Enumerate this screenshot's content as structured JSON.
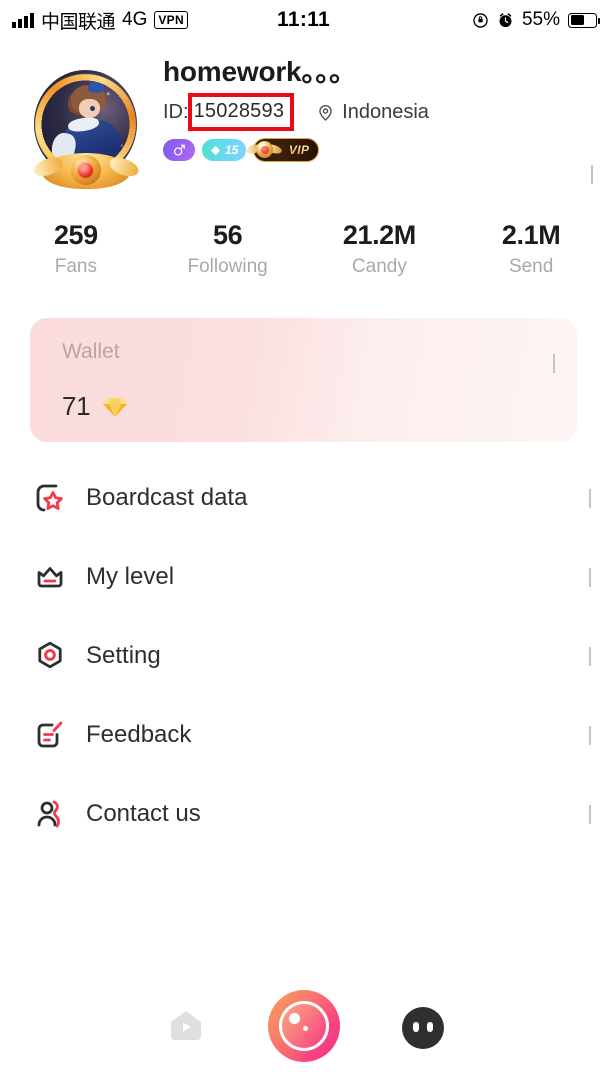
{
  "status_bar": {
    "carrier": "中国联通",
    "network": "4G",
    "vpn": "VPN",
    "time": "11:11",
    "battery_percent": "55%"
  },
  "profile": {
    "username": "homework。。。",
    "id_label": "ID:",
    "id_value": "15028593",
    "location": "Indonesia",
    "badges": {
      "gender": "male",
      "level_value": "15",
      "vip_label": "VIP"
    },
    "highlight_color": "#e50b17"
  },
  "stats": [
    {
      "value": "259",
      "label": "Fans"
    },
    {
      "value": "56",
      "label": "Following"
    },
    {
      "value": "21.2M",
      "label": "Candy"
    },
    {
      "value": "2.1M",
      "label": "Send"
    }
  ],
  "wallet": {
    "title": "Wallet",
    "amount": "71",
    "currency_icon": "diamond-gem-icon"
  },
  "menu": [
    {
      "label": "Boardcast data",
      "icon": "broadcast-star-icon"
    },
    {
      "label": "My level",
      "icon": "crown-icon"
    },
    {
      "label": "Setting",
      "icon": "settings-hexagon-icon"
    },
    {
      "label": "Feedback",
      "icon": "feedback-note-icon"
    },
    {
      "label": "Contact us",
      "icon": "contact-person-icon"
    }
  ],
  "tabbar": {
    "home_label": "home-tab",
    "live_label": "live-tab",
    "me_label": "me-tab",
    "active": "me-tab"
  },
  "colors": {
    "accent_red": "#f23a4d",
    "wallet_pink": "#fbdbdb",
    "live_gradient_start": "#f9a05c",
    "live_gradient_end": "#f52b86"
  }
}
